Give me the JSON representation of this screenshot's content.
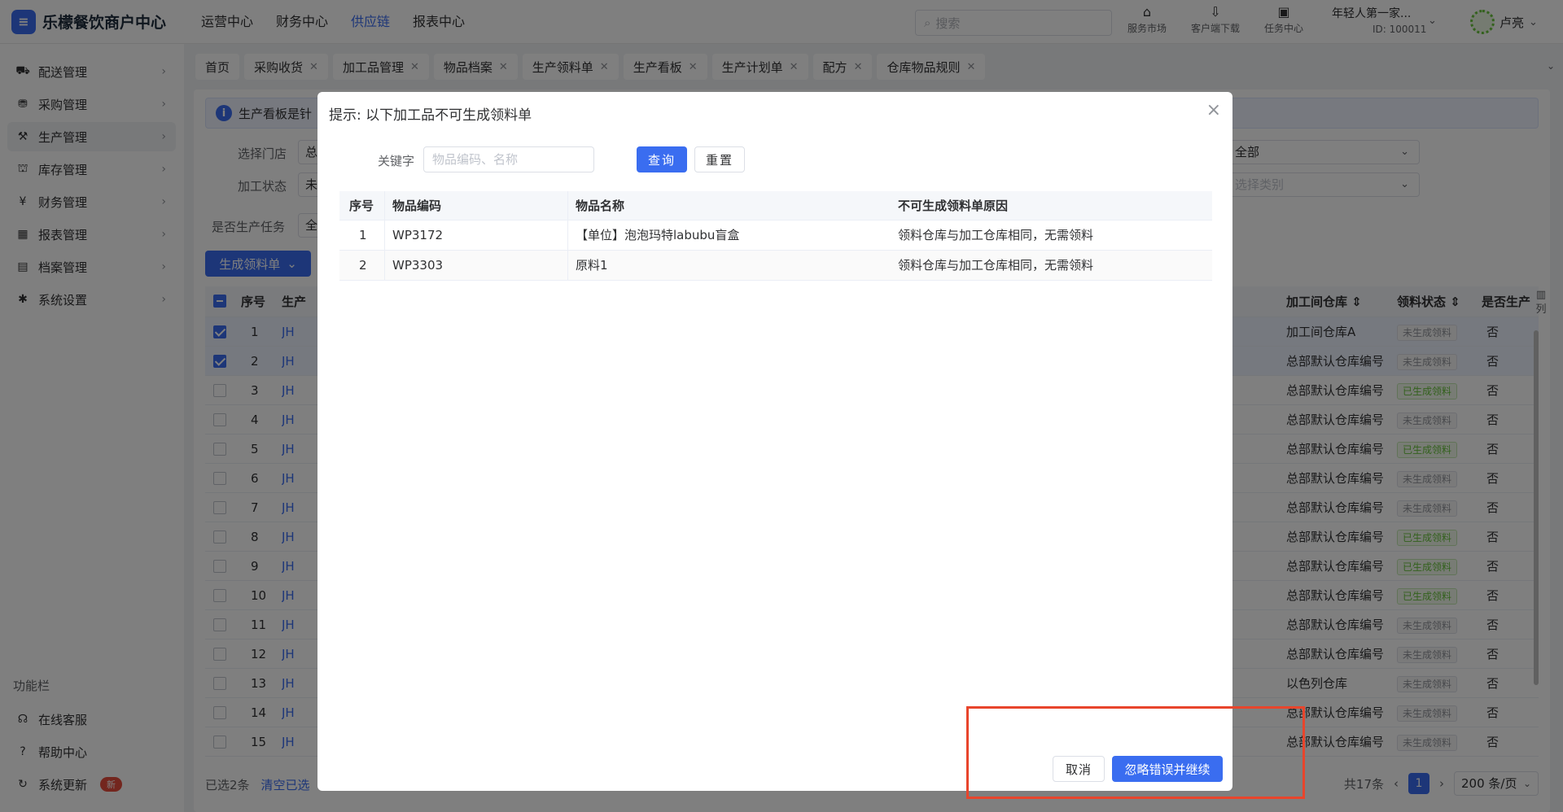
{
  "app": {
    "logo_text": "乐檬餐饮商户中心",
    "logo_letter": "≡",
    "top_nav": [
      "运营中心",
      "财务中心",
      "供应链",
      "报表中心"
    ],
    "active_top_nav": "供应链",
    "search_placeholder": "搜索",
    "tools": [
      {
        "label": "服务市场",
        "icon": "shopping-bag-icon",
        "glyph": "⌂"
      },
      {
        "label": "客户端下载",
        "icon": "download-icon",
        "glyph": "⇩"
      },
      {
        "label": "任务中心",
        "icon": "task-icon",
        "glyph": "▣"
      }
    ],
    "store_name": "年轻人第一家...",
    "store_id": "ID: 100011",
    "user_name": "卢亮"
  },
  "sidebar": {
    "items": [
      {
        "label": "配送管理",
        "icon": "truck-icon",
        "glyph": "⛟"
      },
      {
        "label": "采购管理",
        "icon": "cart-icon",
        "glyph": "⛃"
      },
      {
        "label": "生产管理",
        "icon": "production-icon",
        "glyph": "⚒"
      },
      {
        "label": "库存管理",
        "icon": "warehouse-icon",
        "glyph": "⛫"
      },
      {
        "label": "财务管理",
        "icon": "finance-icon",
        "glyph": "¥"
      },
      {
        "label": "报表管理",
        "icon": "report-icon",
        "glyph": "▦"
      },
      {
        "label": "档案管理",
        "icon": "archive-icon",
        "glyph": "▤"
      },
      {
        "label": "系统设置",
        "icon": "gear-icon",
        "glyph": "✱"
      }
    ],
    "active": "生产管理",
    "section_title": "功能栏",
    "bottom": [
      {
        "label": "在线客服",
        "icon": "headset-icon",
        "glyph": "☊"
      },
      {
        "label": "帮助中心",
        "icon": "help-icon",
        "glyph": "?"
      },
      {
        "label": "系统更新",
        "icon": "refresh-icon",
        "glyph": "↻",
        "badge": "新"
      }
    ]
  },
  "tabs": {
    "items": [
      {
        "label": "首页",
        "closable": false
      },
      {
        "label": "采购收货",
        "closable": true
      },
      {
        "label": "加工品管理",
        "closable": true
      },
      {
        "label": "物品档案",
        "closable": true
      },
      {
        "label": "生产领料单",
        "closable": true
      },
      {
        "label": "生产看板",
        "closable": true
      },
      {
        "label": "生产计划单",
        "closable": true
      },
      {
        "label": "配方",
        "closable": true
      },
      {
        "label": "仓库物品规则",
        "closable": true
      }
    ],
    "active": "生产看板"
  },
  "page": {
    "notice": "生产看板是针",
    "filters": {
      "store_label": "选择门店",
      "store_value": "总",
      "status_label": "加工状态",
      "status_value": "未",
      "task_label": "是否生产任务",
      "task_value": "全",
      "right_select_1": "全部",
      "right_select_2_placeholder": "选择类别"
    },
    "generate_button": "生成领料单",
    "table": {
      "left_headers": [
        "序号",
        "生产"
      ],
      "right_headers": [
        "加工间仓库",
        "领料状态",
        "是否生产"
      ],
      "column_setting": "列",
      "rows": [
        {
          "no": "1",
          "code": "JH",
          "warehouse": "加工间仓库A",
          "status": "未生成领料",
          "done": false,
          "produce": "否",
          "checked": true
        },
        {
          "no": "2",
          "code": "JH",
          "warehouse": "总部默认仓库编号",
          "status": "未生成领料",
          "done": false,
          "produce": "否",
          "checked": true
        },
        {
          "no": "3",
          "code": "JH",
          "warehouse": "总部默认仓库编号",
          "status": "已生成领料",
          "done": true,
          "produce": "否",
          "checked": false
        },
        {
          "no": "4",
          "code": "JH",
          "warehouse": "总部默认仓库编号",
          "status": "未生成领料",
          "done": false,
          "produce": "否",
          "checked": false
        },
        {
          "no": "5",
          "code": "JH",
          "warehouse": "总部默认仓库编号",
          "status": "已生成领料",
          "done": true,
          "produce": "否",
          "checked": false
        },
        {
          "no": "6",
          "code": "JH",
          "warehouse": "总部默认仓库编号",
          "status": "未生成领料",
          "done": false,
          "produce": "否",
          "checked": false
        },
        {
          "no": "7",
          "code": "JH",
          "warehouse": "总部默认仓库编号",
          "status": "未生成领料",
          "done": false,
          "produce": "否",
          "checked": false
        },
        {
          "no": "8",
          "code": "JH",
          "warehouse": "总部默认仓库编号",
          "status": "已生成领料",
          "done": true,
          "produce": "否",
          "checked": false
        },
        {
          "no": "9",
          "code": "JH",
          "warehouse": "总部默认仓库编号",
          "status": "已生成领料",
          "done": true,
          "produce": "否",
          "checked": false
        },
        {
          "no": "10",
          "code": "JH",
          "warehouse": "总部默认仓库编号",
          "status": "已生成领料",
          "done": true,
          "produce": "否",
          "checked": false
        },
        {
          "no": "11",
          "code": "JH",
          "warehouse": "总部默认仓库编号",
          "status": "未生成领料",
          "done": false,
          "produce": "否",
          "checked": false
        },
        {
          "no": "12",
          "code": "JH",
          "warehouse": "总部默认仓库编号",
          "status": "未生成领料",
          "done": false,
          "produce": "否",
          "checked": false
        },
        {
          "no": "13",
          "code": "JH",
          "warehouse": "以色列仓库",
          "status": "未生成领料",
          "done": false,
          "produce": "否",
          "checked": false
        },
        {
          "no": "14",
          "code": "JH",
          "warehouse": "总部默认仓库编号",
          "status": "未生成领料",
          "done": false,
          "produce": "否",
          "checked": false
        },
        {
          "no": "15",
          "code": "JH",
          "warehouse": "总部默认仓库编号",
          "status": "未生成领料",
          "done": false,
          "produce": "否",
          "checked": false
        }
      ]
    },
    "footer": {
      "selected": "已选2条",
      "clear": "清空已选",
      "total": "共17条",
      "page": "1",
      "page_size": "200 条/页"
    }
  },
  "modal": {
    "title": "提示: 以下加工品不可生成领料单",
    "keyword_label": "关键字",
    "keyword_placeholder": "物品编码、名称",
    "query_button": "查询",
    "reset_button": "重置",
    "headers": [
      "序号",
      "物品编码",
      "物品名称",
      "不可生成领料单原因"
    ],
    "rows": [
      [
        "1",
        "WP3172",
        "【单位】泡泡玛特labubu盲盒",
        "领料仓库与加工仓库相同，无需领料"
      ],
      [
        "2",
        "WP3303",
        "原料1",
        "领料仓库与加工仓库相同，无需领料"
      ]
    ],
    "cancel_button": "取消",
    "continue_button": "忽略错误并继续"
  }
}
